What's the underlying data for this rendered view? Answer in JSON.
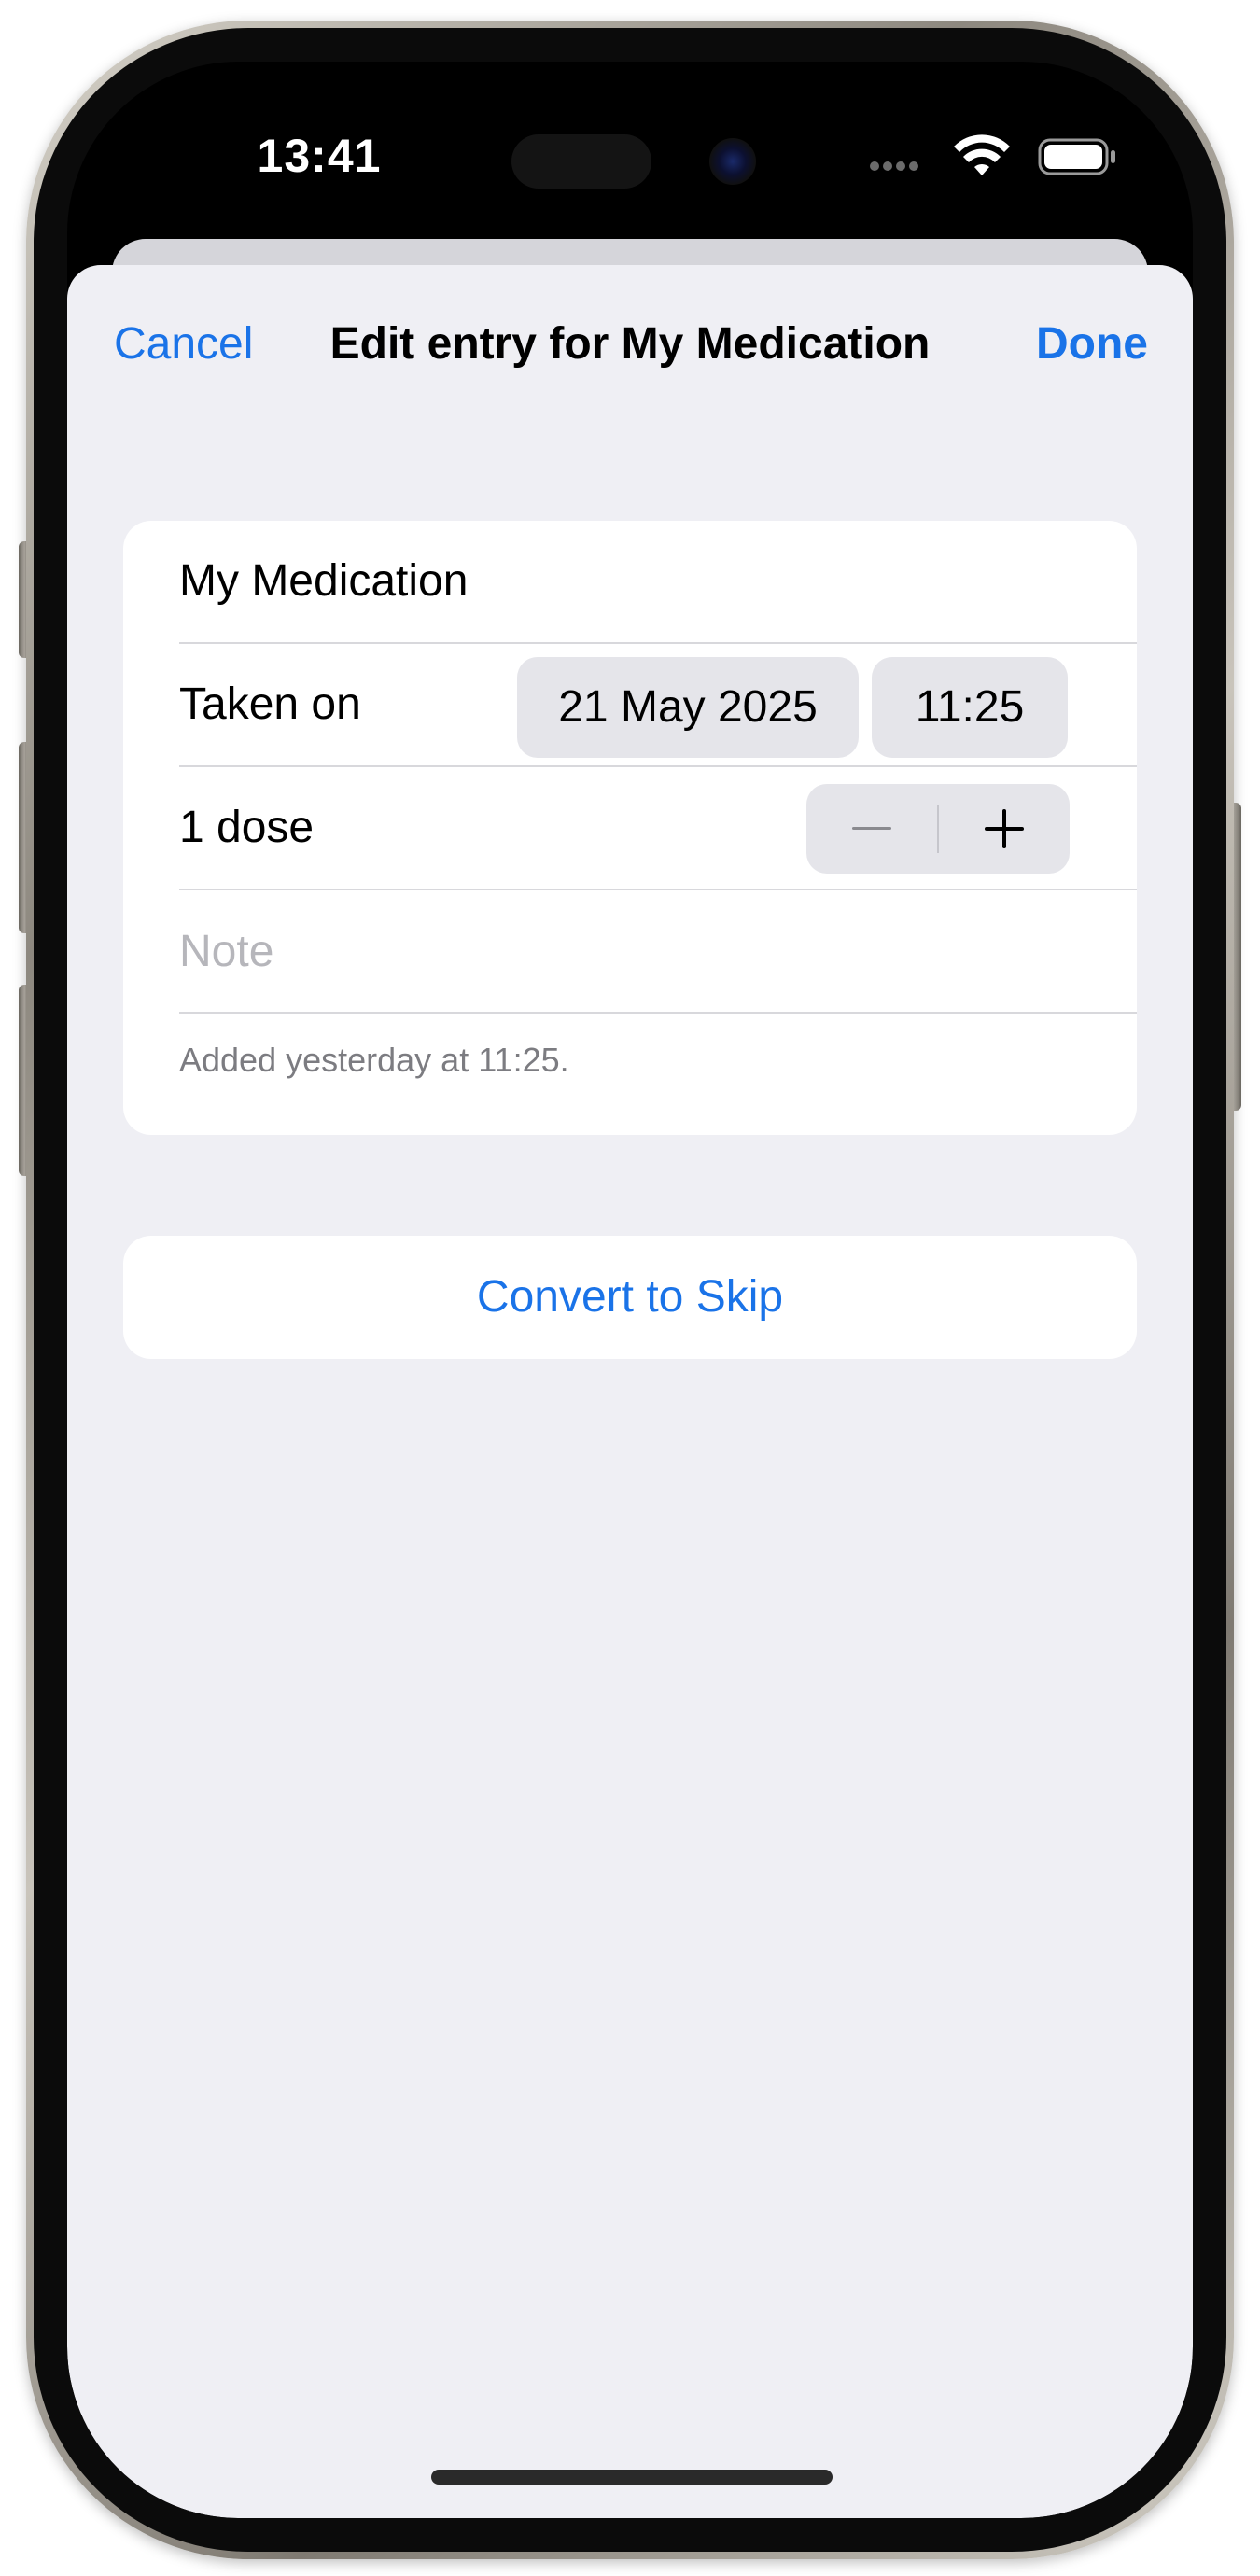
{
  "status_bar": {
    "time": "13:41",
    "icons": [
      "cellular-dots-icon",
      "wifi-icon",
      "battery-icon"
    ]
  },
  "nav": {
    "cancel_label": "Cancel",
    "title": "Edit entry for My Medication",
    "done_label": "Done"
  },
  "form": {
    "medication_name": "My Medication",
    "taken_on_label": "Taken on",
    "date_value": "21 May 2025",
    "time_value": "11:25",
    "dose_label": "1 dose",
    "stepper_icons": [
      "minus-icon",
      "plus-icon"
    ],
    "note_placeholder": "Note",
    "note_value": "",
    "footer": "Added yesterday at 11:25."
  },
  "actions": {
    "convert_label": "Convert to Skip"
  },
  "colors": {
    "accent": "#1a73e8",
    "sheet_background": "#efeff4",
    "card_background": "#ffffff",
    "secondary_text": "#7c7c81",
    "placeholder_text": "#b6b6bb",
    "control_fill": "#e5e5ea"
  }
}
